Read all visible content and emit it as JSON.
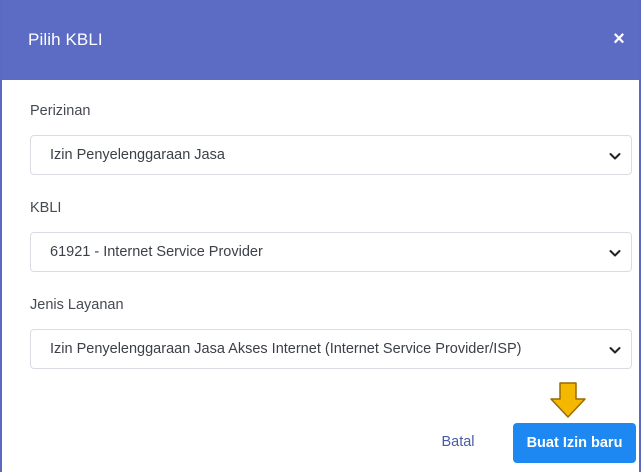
{
  "dialog": {
    "title": "Pilih KBLI",
    "close_glyph": "×"
  },
  "fields": {
    "perizinan": {
      "label": "Perizinan",
      "selected": "Izin Penyelenggaraan Jasa"
    },
    "kbli": {
      "label": "KBLI",
      "selected": "61921 - Internet Service Provider"
    },
    "jenis_layanan": {
      "label": "Jenis Layanan",
      "selected": "Izin Penyelenggaraan Jasa Akses Internet (Internet Service Provider/ISP)"
    }
  },
  "footer": {
    "cancel_label": "Batal",
    "submit_label": "Buat Izin baru"
  },
  "icons": {
    "close": "close-icon",
    "dropdown": "chevron-down-icon",
    "hint": "arrow-down-icon"
  },
  "colors": {
    "header": "#5c6bc4",
    "primary": "#1e88f2",
    "cancel_text": "#4a5aa9",
    "hint_arrow": "#f5b800"
  }
}
